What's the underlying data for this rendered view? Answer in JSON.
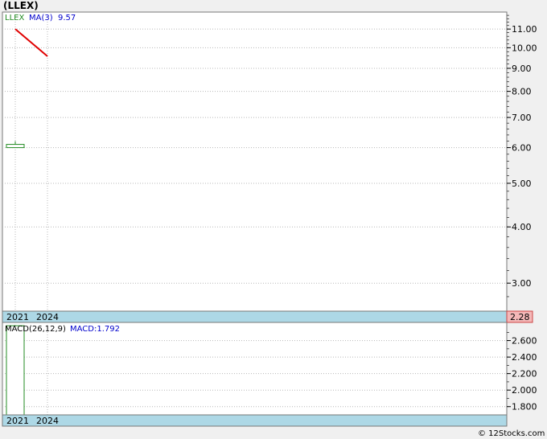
{
  "title": "(LLEX)",
  "credit": "© 12Stocks.com",
  "colors": {
    "background": "#f0f0f0",
    "panel": "#ffffff",
    "grid": "#b8b8b8",
    "band": "#add8e6",
    "ticker_text": "#228b22",
    "ma_text": "#0000cc",
    "ma_line": "#e00000",
    "candle": "#228b22",
    "macd_bar": "#228b22",
    "last_price_box": "#f4b8b8"
  },
  "chart_data": [
    {
      "type": "candlestick",
      "legend": {
        "ticker": "LLEX",
        "ma_label": "MA(3)",
        "ma_value": "9.57"
      },
      "y_scale": "log",
      "ylim": [
        2.6,
        12.0
      ],
      "y_ticks": [
        "11.00",
        "10.00",
        "9.00",
        "8.00",
        "7.00",
        "6.00",
        "5.00",
        "4.00",
        "3.00"
      ],
      "x_labels": [
        "2021",
        "2024"
      ],
      "last_price_label": "2.28",
      "candles": [
        {
          "x": "2021",
          "open": 6.0,
          "high": 6.2,
          "low": 6.0,
          "close": 6.1
        }
      ],
      "ma_line": [
        {
          "x": "2021",
          "y": 11.0
        },
        {
          "x": "2024",
          "y": 9.57
        }
      ]
    },
    {
      "type": "bar",
      "legend": {
        "label": "MACD(26,12,9)",
        "value_label": "MACD:1.792"
      },
      "ylim": [
        1.7,
        2.82
      ],
      "y_ticks": [
        "2.600",
        "2.400",
        "2.200",
        "2.000",
        "1.800"
      ],
      "x_labels": [
        "2021",
        "2024"
      ],
      "bars": [
        {
          "x": "2021",
          "value": 2.78
        }
      ]
    }
  ]
}
